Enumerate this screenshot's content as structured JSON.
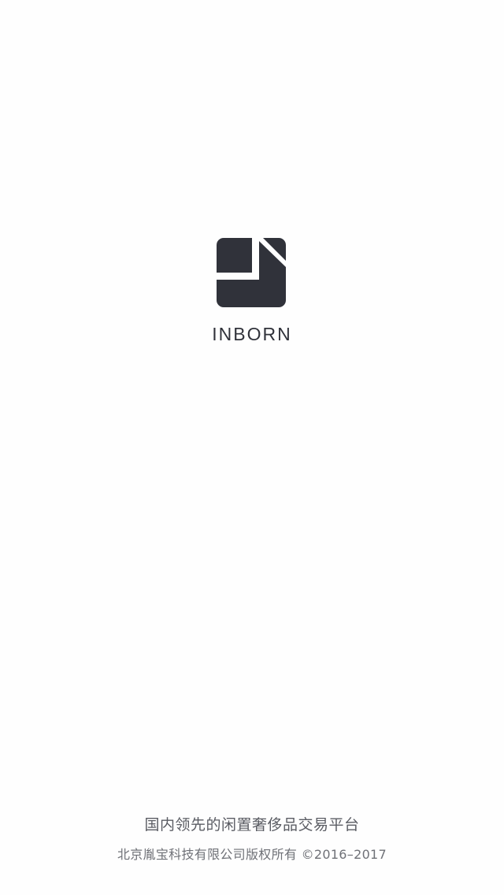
{
  "brand": {
    "name": "INBORN",
    "logo_color": "#30323a"
  },
  "footer": {
    "slogan": "国内领先的闲置奢侈品交易平台",
    "copyright": "北京胤宝科技有限公司版权所有 ©2016–2017"
  }
}
